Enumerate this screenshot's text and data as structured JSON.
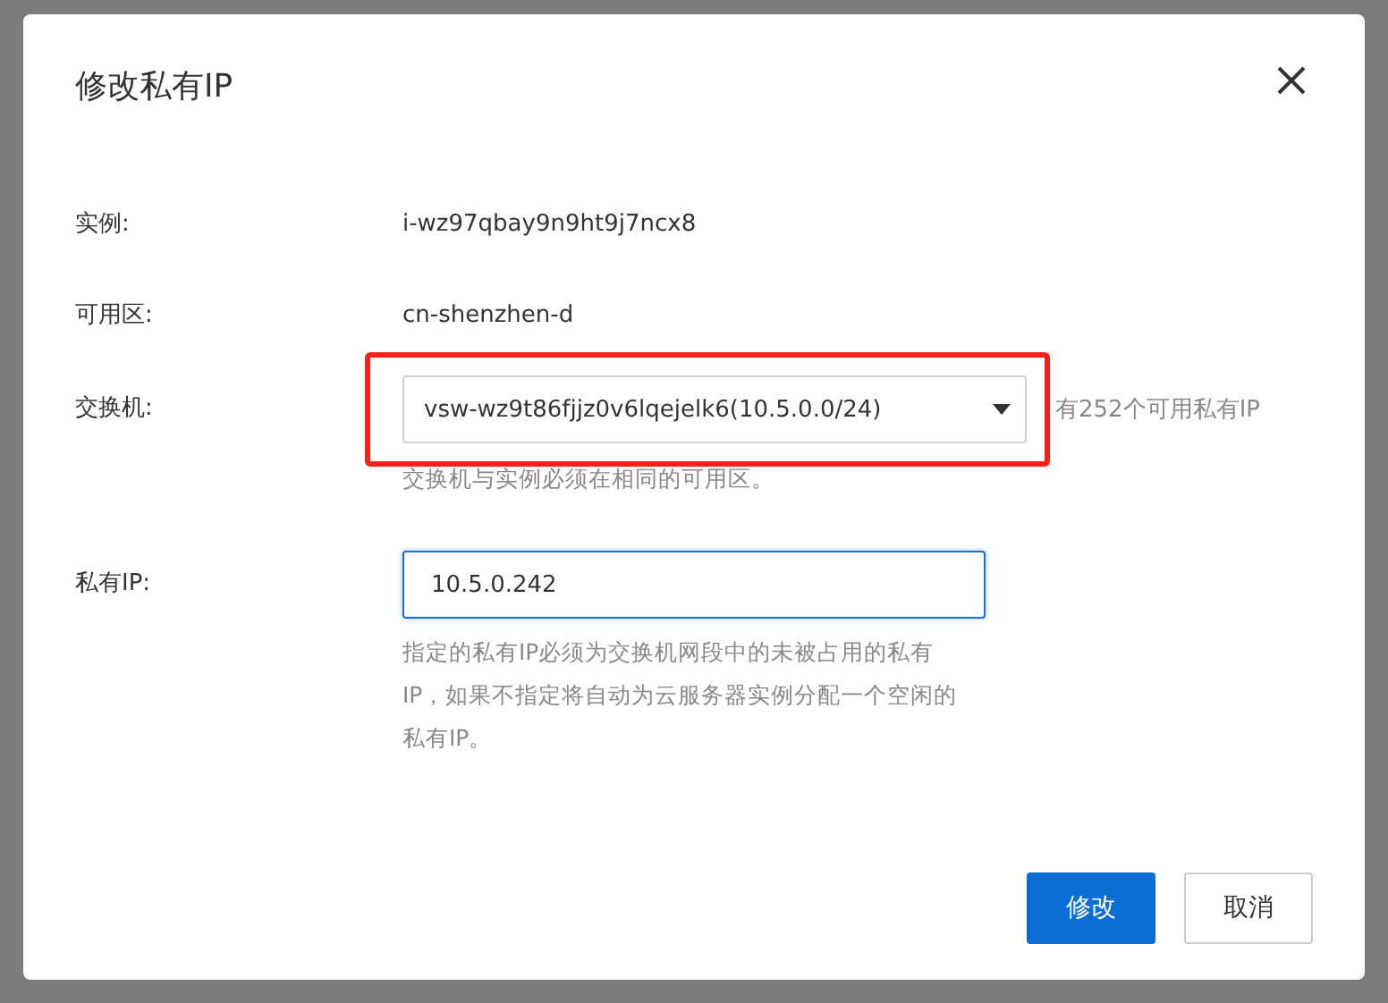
{
  "dialog": {
    "title": "修改私有IP",
    "fields": [
      {
        "kind": "text",
        "label": "实例:",
        "value": "i-wz97qbay9n9ht9j7ncx8"
      },
      {
        "kind": "text",
        "label": "可用区:",
        "value": "cn-shenzhen-d"
      },
      {
        "kind": "select",
        "label": "交换机:",
        "value": "vsw-wz9t86fjjz0v6lqejelk6(10.5.0.0/24)",
        "highlighted": true,
        "side_note": "有252个可用私有IP",
        "help": "交换机与实例必须在相同的可用区。"
      },
      {
        "kind": "input",
        "label": "私有IP:",
        "value": "10.5.0.242",
        "focused": true,
        "help": "指定的私有IP必须为交换机网段中的未被占用的私有IP，如果不指定将自动为云服务器实例分配一个空闲的私有IP。"
      }
    ],
    "buttons": [
      {
        "label": "修改",
        "primary": true
      },
      {
        "label": "取消",
        "primary": false
      }
    ]
  }
}
